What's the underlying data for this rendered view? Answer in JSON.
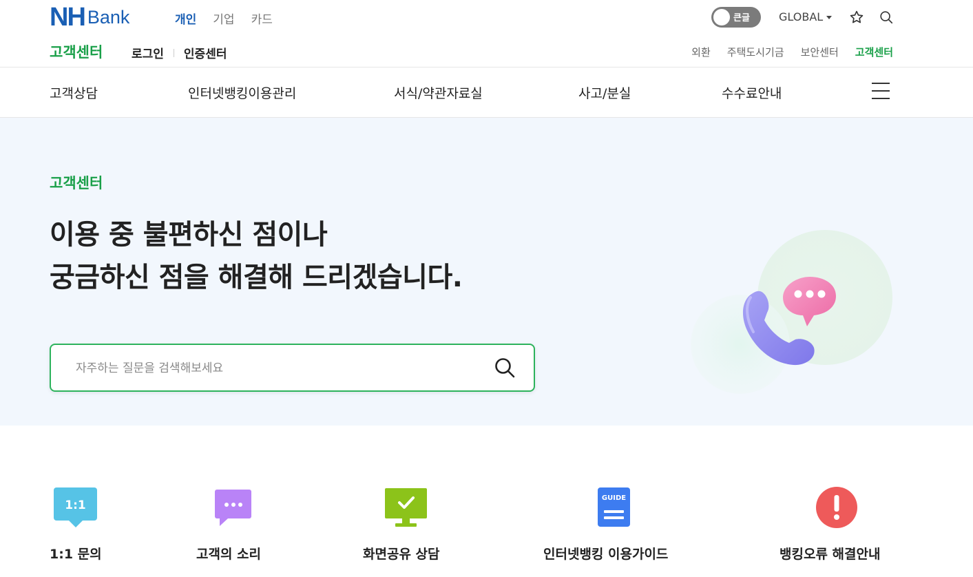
{
  "brand": {
    "logo_primary": "NH",
    "logo_secondary": "Bank",
    "color": "#1a5fb4"
  },
  "top_nav": {
    "links": [
      {
        "label": "개인",
        "active": true
      },
      {
        "label": "기업",
        "active": false
      },
      {
        "label": "카드",
        "active": false
      }
    ],
    "font_toggle_label": "큰글",
    "global_label": "GLOBAL",
    "icons": [
      "star-icon",
      "search-icon"
    ]
  },
  "sub_header": {
    "title": "고객센터",
    "links": [
      "로그인",
      "인증센터"
    ],
    "right_links": [
      {
        "label": "외환",
        "active": false
      },
      {
        "label": "주택도시기금",
        "active": false
      },
      {
        "label": "보안센터",
        "active": false
      },
      {
        "label": "고객센터",
        "active": true
      }
    ]
  },
  "main_nav": {
    "items": [
      "고객상담",
      "인터넷뱅킹이용관리",
      "서식/약관자료실",
      "사고/분실",
      "수수료안내"
    ],
    "menu_icon": "hamburger-menu-icon"
  },
  "hero": {
    "eyebrow": "고객센터",
    "headline_line1": "이용 중 불편하신 점이나",
    "headline_line2": "궁금하신 점을 해결해 드리겠습니다.",
    "search": {
      "placeholder": "자주하는 질문을 검색해보세요",
      "value": ""
    },
    "illustration": "phone-chat-icon"
  },
  "quick_menu": [
    {
      "label": "1:1 문의",
      "icon": "one-to-one-chat-icon",
      "icon_text": "1:1",
      "color": "#56c3e6"
    },
    {
      "label": "고객의 소리",
      "icon": "speech-bubble-icon",
      "color": "#b983f7"
    },
    {
      "label": "화면공유 상담",
      "icon": "monitor-check-icon",
      "color": "#8cc31a"
    },
    {
      "label": "인터넷뱅킹 이용가이드",
      "icon": "guide-document-icon",
      "icon_text": "GUIDE",
      "color": "#3d7cf0"
    },
    {
      "label": "뱅킹오류 해결안내",
      "icon": "alert-icon",
      "color": "#ee5a5a"
    }
  ],
  "colors": {
    "accent_green": "#1aa049",
    "search_border": "#2db35c",
    "hero_bg": "#f2f7fd"
  }
}
